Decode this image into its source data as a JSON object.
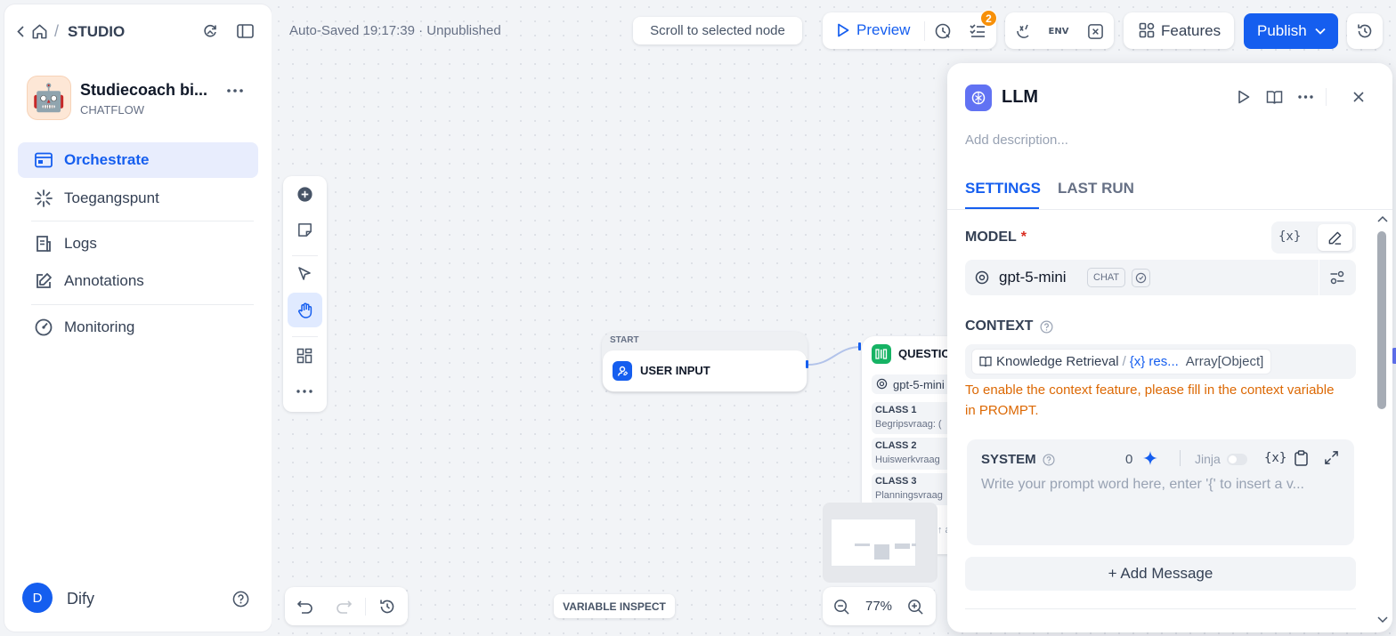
{
  "sidebar": {
    "breadcrumb_label": "STUDIO",
    "app": {
      "name": "Studiecoach bi...",
      "type": "CHATFLOW",
      "avatar_emoji": "🤖"
    },
    "nav": [
      {
        "label": "Orchestrate"
      },
      {
        "label": "Toegangspunt"
      },
      {
        "label": "Logs"
      },
      {
        "label": "Annotations"
      },
      {
        "label": "Monitoring"
      }
    ],
    "user": {
      "initial": "D",
      "name": "Dify"
    }
  },
  "topbar": {
    "status": "Auto-Saved 19:17:39 · Unpublished",
    "scroll_btn": "Scroll to selected node",
    "preview_label": "Preview",
    "checklist_badge": "2",
    "env_label": "ENV",
    "features_label": "Features",
    "publish_label": "Publish"
  },
  "canvas": {
    "start_node": {
      "tag": "START",
      "title": "USER INPUT"
    },
    "question_node": {
      "title": "QUESTIO",
      "model": "gpt-5-mini",
      "classes": [
        {
          "label": "CLASS 1",
          "desc": "Begripsvraag: ("
        },
        {
          "label": "CLASS 2",
          "desc": "Huiswerkvraag"
        },
        {
          "label": "CLASS 3",
          "desc": "Planningsvraag"
        }
      ],
      "footer_fragment": "↑ a"
    },
    "variable_inspect": "VARIABLE INSPECT",
    "zoom_label": "77%"
  },
  "panel": {
    "title": "LLM",
    "description_placeholder": "Add description...",
    "tabs": [
      {
        "label": "SETTINGS"
      },
      {
        "label": "LAST RUN"
      }
    ],
    "model_label": "MODEL",
    "required_mark": "*",
    "var_btn": "{x}",
    "model_name": "gpt-5-mini",
    "model_mode": "CHAT",
    "context_label": "CONTEXT",
    "context_source": "Knowledge Retrieval",
    "context_sep": "/",
    "context_var": "{x} res...",
    "context_type": "Array[Object]",
    "context_warning": "To enable the context feature, please fill in the context variable in PROMPT.",
    "system_label": "SYSTEM",
    "system_count": "0",
    "jinja_label": "Jinja",
    "system_placeholder": "Write your prompt word here, enter '{' to insert a v...",
    "add_message": "+ Add Message"
  },
  "colors": {
    "accent": "#155eef",
    "warning": "#dc6803",
    "node_green": "#16b364",
    "llm_icon": "#6172f3"
  }
}
